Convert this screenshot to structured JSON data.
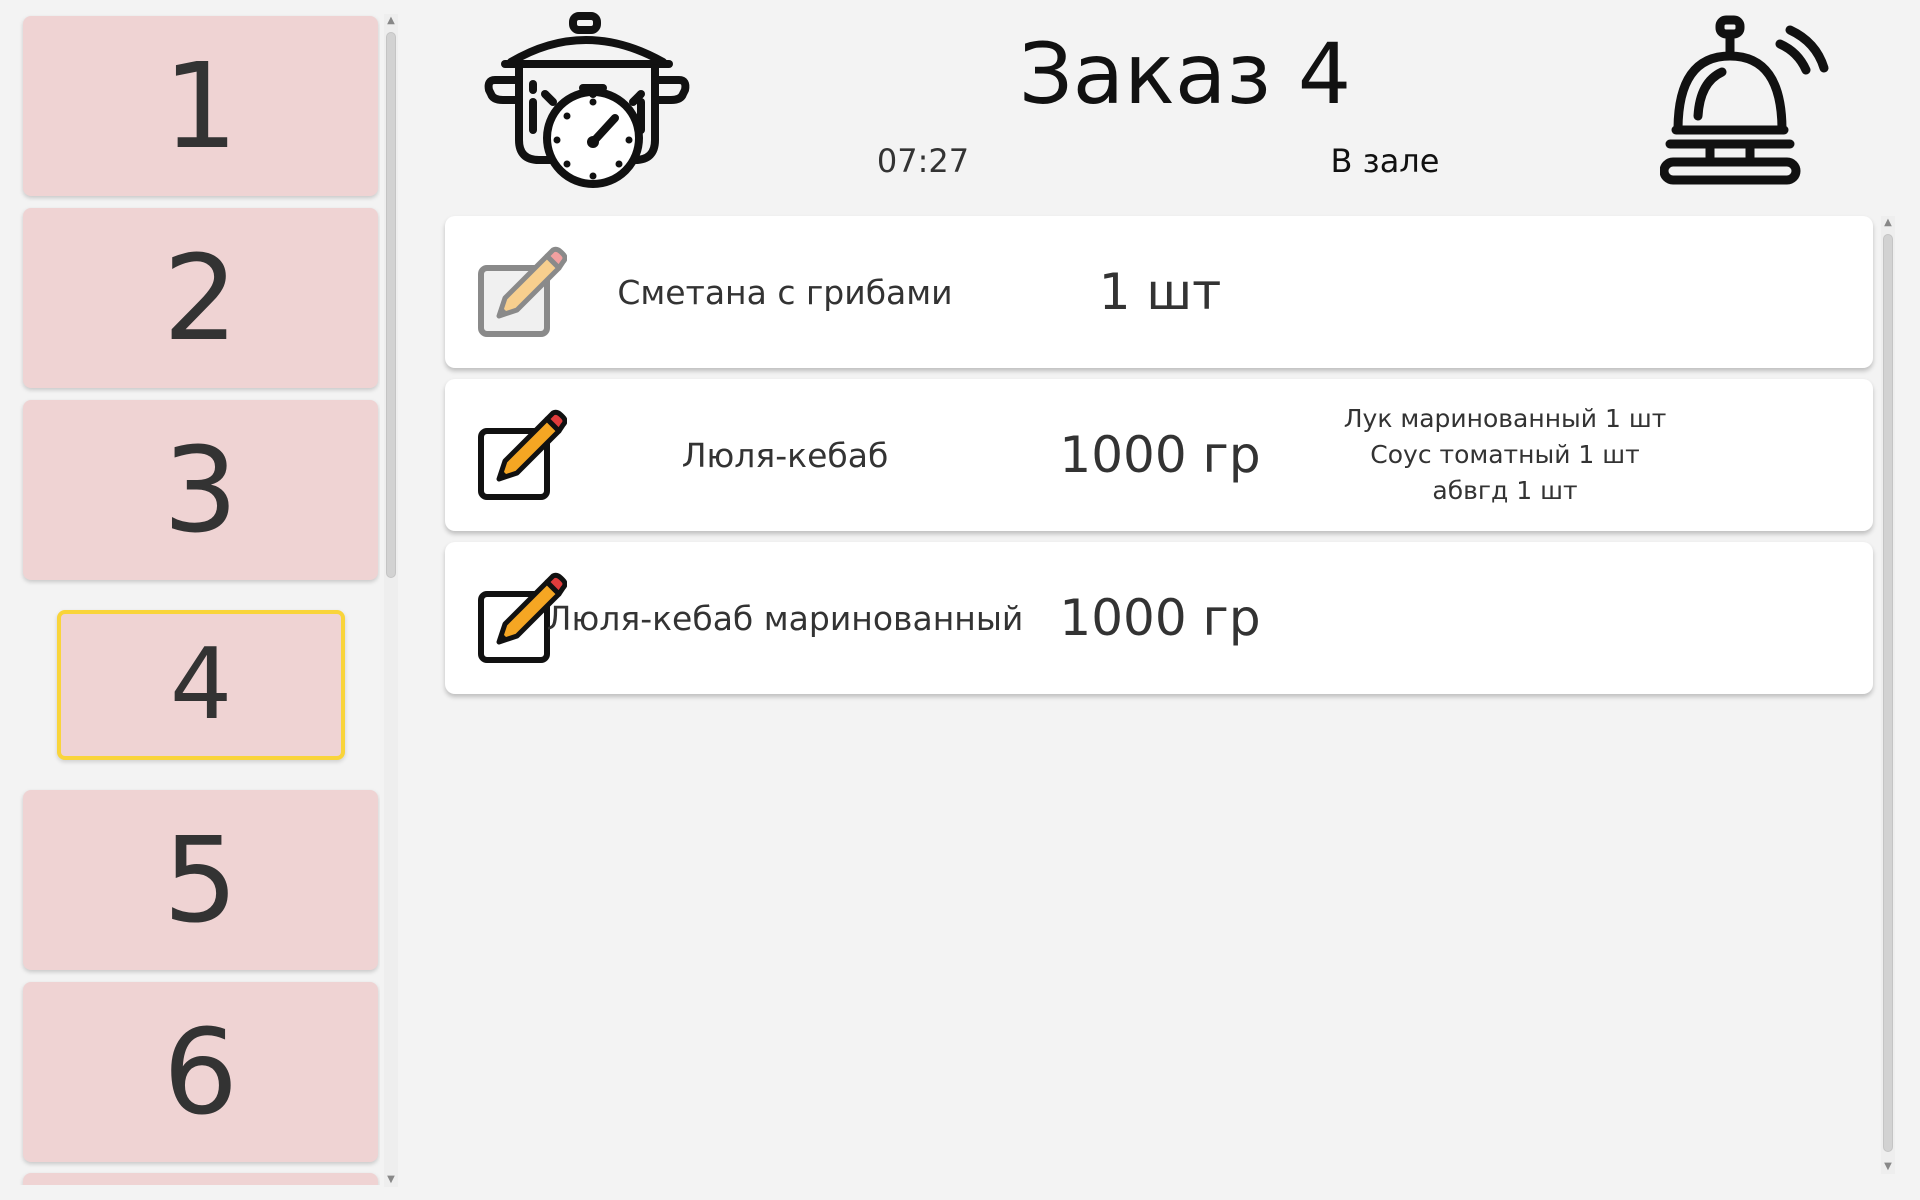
{
  "orders": [
    "1",
    "2",
    "3",
    "4",
    "5",
    "6"
  ],
  "active_order": "4",
  "header": {
    "title": "Заказ 4",
    "time": "07:27",
    "location": "В зале",
    "left_icon": "pot-timer-icon",
    "right_icon": "service-bell-icon"
  },
  "items": [
    {
      "name": "Сметана с грибами",
      "qty": "1 шт",
      "mods": [],
      "edit_icon": "pencil-edit-icon",
      "edit_state": "disabled"
    },
    {
      "name": "Люля-кебаб",
      "qty": "1000 гр",
      "mods": [
        "Лук маринованный 1 шт",
        "Соус томатный 1 шт",
        "абвгд 1 шт"
      ],
      "edit_icon": "pencil-edit-icon",
      "edit_state": "enabled"
    },
    {
      "name": "Люля-кебаб маринованный",
      "qty": "1000 гр",
      "mods": [],
      "edit_icon": "pencil-edit-icon",
      "edit_state": "enabled"
    }
  ],
  "colors": {
    "background": "#f3f3f3",
    "order_button": "#efd3d3",
    "active_border": "#f9d43a",
    "card": "#ffffff",
    "pencil_orange": "#f5a623",
    "pencil_tip": "#e03c3c"
  }
}
